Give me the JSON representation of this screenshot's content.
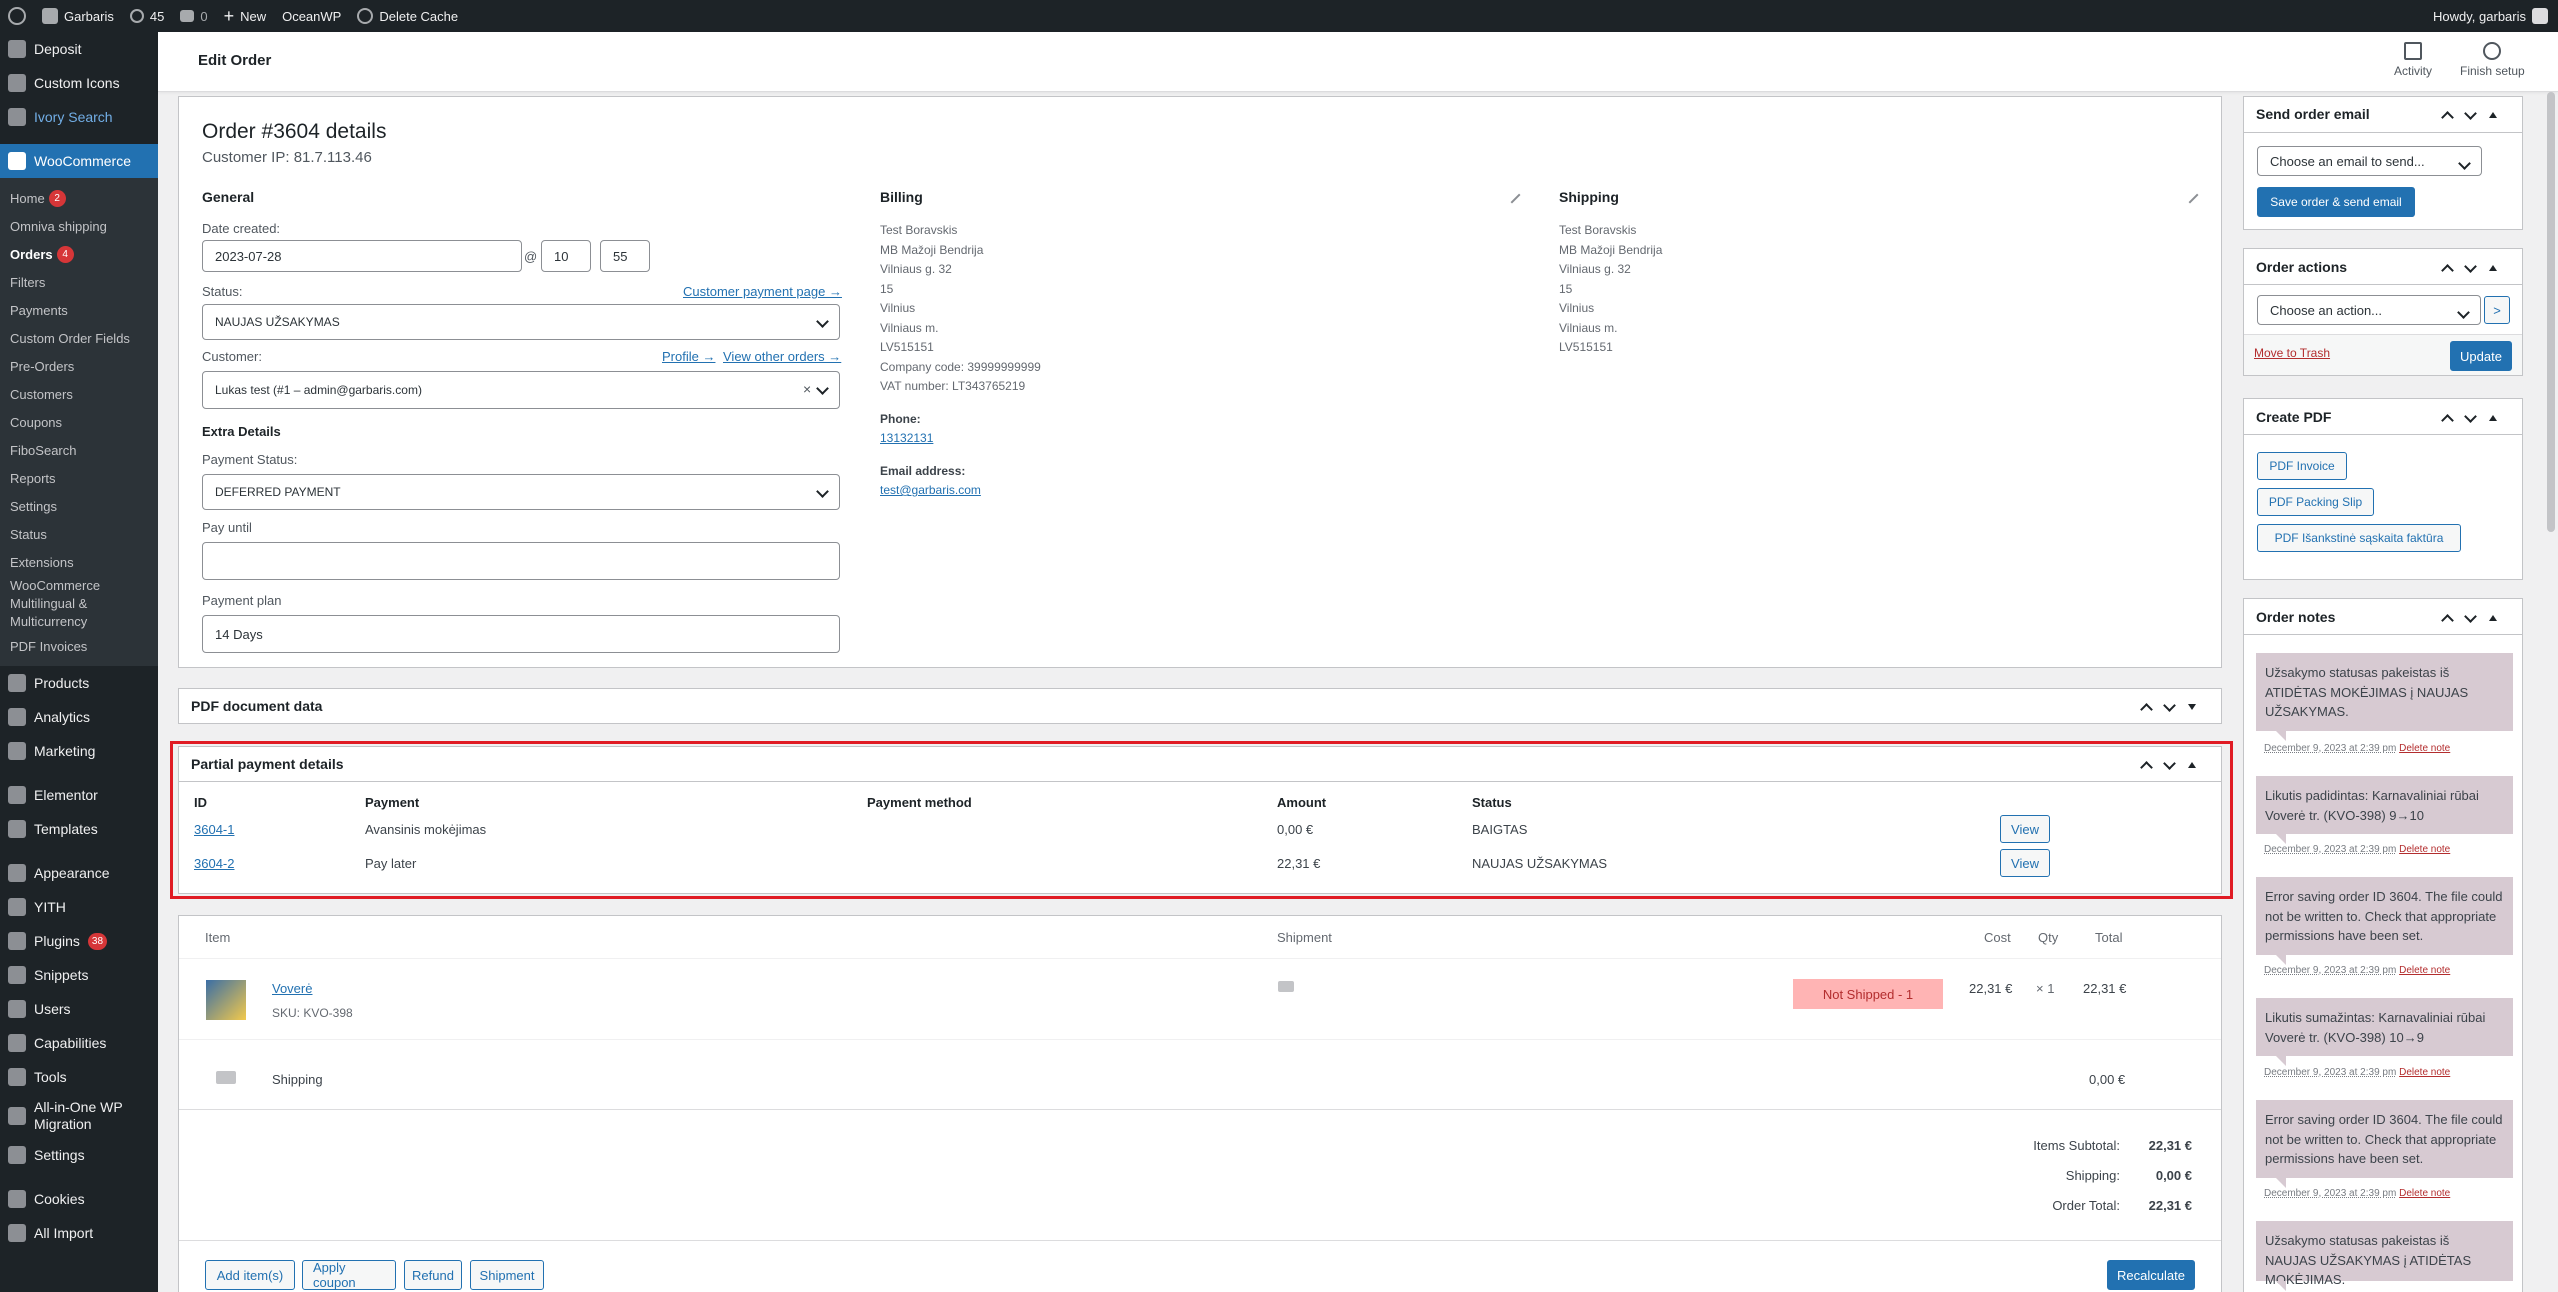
{
  "adminbar": {
    "site": "Garbaris",
    "updates": "45",
    "comments": "0",
    "new": "New",
    "oceanwp": "OceanWP",
    "cache": "Delete Cache",
    "howdy": "Howdy, garbaris"
  },
  "sidebar": {
    "top": [
      {
        "label": "Deposit"
      },
      {
        "label": "Custom Icons"
      },
      {
        "label": "Ivory Search"
      }
    ],
    "woo": "WooCommerce",
    "sub": [
      {
        "label": "Home",
        "badge": "2"
      },
      {
        "label": "Omniva shipping"
      },
      {
        "label": "Orders",
        "badge": "4"
      },
      {
        "label": "Filters"
      },
      {
        "label": "Payments"
      },
      {
        "label": "Custom Order Fields"
      },
      {
        "label": "Pre-Orders"
      },
      {
        "label": "Customers"
      },
      {
        "label": "Coupons"
      },
      {
        "label": "FiboSearch"
      },
      {
        "label": "Reports"
      },
      {
        "label": "Settings"
      },
      {
        "label": "Status"
      },
      {
        "label": "Extensions"
      },
      {
        "label": "WooCommerce Multilingual & Multicurrency"
      },
      {
        "label": "PDF Invoices"
      }
    ],
    "bottom": [
      {
        "label": "Products"
      },
      {
        "label": "Analytics"
      },
      {
        "label": "Marketing"
      },
      {
        "label": "Elementor"
      },
      {
        "label": "Templates"
      },
      {
        "label": "Appearance"
      },
      {
        "label": "YITH"
      },
      {
        "label": "Plugins",
        "badge": "38"
      },
      {
        "label": "Snippets"
      },
      {
        "label": "Users"
      },
      {
        "label": "Capabilities"
      },
      {
        "label": "Tools"
      },
      {
        "label": "All-in-One WP Migration"
      },
      {
        "label": "Settings"
      },
      {
        "label": "Cookies"
      },
      {
        "label": "All Import"
      }
    ]
  },
  "header": {
    "title": "Edit Order",
    "activity": "Activity",
    "finish": "Finish setup"
  },
  "order": {
    "title": "Order #3604 details",
    "ip": "Customer IP: 81.7.113.46",
    "general": "General",
    "date_label": "Date created:",
    "date": "2023-07-28",
    "at": "@",
    "hour": "10",
    "minute": "55",
    "status_label": "Status:",
    "payment_page": "Customer payment page →",
    "status": "NAUJAS UŽSAKYMAS",
    "customer_label": "Customer:",
    "profile": "Profile →",
    "other_orders": "View other orders →",
    "customer": "Lukas test (#1 – admin@garbaris.com)",
    "clear": "×",
    "extra": "Extra Details",
    "pay_status_label": "Payment Status:",
    "pay_status": "DEFERRED PAYMENT",
    "pay_until_label": "Pay until",
    "pay_until": "",
    "plan_label": "Payment plan",
    "plan": "14 Days",
    "billing": "Billing",
    "billing_lines": [
      "Test Boravskis",
      "MB Mažoji Bendrija",
      "Vilniaus g. 32",
      "15",
      "Vilnius",
      "Vilniaus m.",
      "LV515151",
      "Company code: 39999999999",
      "VAT number: LT343765219"
    ],
    "phone_label": "Phone:",
    "phone": "13132131",
    "email_label": "Email address:",
    "email": "test@garbaris.com",
    "shipping": "Shipping",
    "shipping_lines": [
      "Test Boravskis",
      "MB Mažoji Bendrija",
      "Vilniaus g. 32",
      "15",
      "Vilnius",
      "Vilniaus m.",
      "LV515151"
    ]
  },
  "pdfbox": {
    "title": "PDF document data"
  },
  "partial": {
    "title": "Partial payment details",
    "cols": [
      "ID",
      "Payment",
      "Payment method",
      "Amount",
      "Status"
    ],
    "rows": [
      {
        "id": "3604-1",
        "payment": "Avansinis mokėjimas",
        "method": "",
        "amount": "0,00 €",
        "status": "BAIGTAS",
        "view": "View"
      },
      {
        "id": "3604-2",
        "payment": "Pay later",
        "method": "",
        "amount": "22,31 €",
        "status": "NAUJAS UŽSAKYMAS",
        "view": "View"
      }
    ]
  },
  "items": {
    "cols": {
      "item": "Item",
      "shipment": "Shipment",
      "cost": "Cost",
      "qty": "Qty",
      "total": "Total"
    },
    "product": {
      "name": "Voverė",
      "sku": "SKU: KVO-398",
      "badge": "Not Shipped - 1",
      "cost": "22,31 €",
      "qty": "× 1",
      "total": "22,31 €"
    },
    "shipping": {
      "label": "Shipping",
      "total": "0,00 €"
    },
    "totals": [
      {
        "label": "Items Subtotal:",
        "value": "22,31 €"
      },
      {
        "label": "Shipping:",
        "value": "0,00 €"
      },
      {
        "label": "Order Total:",
        "value": "22,31 €"
      }
    ],
    "buttons": {
      "add": "Add item(s)",
      "coupon": "Apply coupon",
      "refund": "Refund",
      "shipment": "Shipment",
      "recalc": "Recalculate"
    }
  },
  "send_email": {
    "title": "Send order email",
    "placeholder": "Choose an email to send...",
    "button": "Save order & send email"
  },
  "actions": {
    "title": "Order actions",
    "placeholder": "Choose an action...",
    "go": ">",
    "trash": "Move to Trash",
    "update": "Update"
  },
  "create_pdf": {
    "title": "Create PDF",
    "buttons": [
      "PDF Invoice",
      "PDF Packing Slip",
      "PDF Išankstinė sąskaita faktūra"
    ]
  },
  "notes": {
    "title": "Order notes",
    "delete": "Delete note",
    "items": [
      {
        "text": "Užsakymo statusas pakeistas iš ATIDĖTAS MOKĖJIMAS į NAUJAS UŽSAKYMAS.",
        "date": "December 9, 2023 at 2:39 pm"
      },
      {
        "text": "Likutis padidintas: Karnavaliniai rūbai Voverė tr. (KVO-398) 9→10",
        "date": "December 9, 2023 at 2:39 pm"
      },
      {
        "text": "Error saving order ID 3604. The file could not be written to. Check that appropriate permissions have been set.",
        "date": "December 9, 2023 at 2:39 pm"
      },
      {
        "text": "Likutis sumažintas: Karnavaliniai rūbai Voverė tr. (KVO-398) 10→9",
        "date": "December 9, 2023 at 2:39 pm"
      },
      {
        "text": "Error saving order ID 3604. The file could not be written to. Check that appropriate permissions have been set.",
        "date": "December 9, 2023 at 2:39 pm"
      },
      {
        "text": "Užsakymo statusas pakeistas iš NAUJAS UŽSAKYMAS į ATIDĖTAS MOKĖJIMAS.",
        "date": ""
      }
    ]
  }
}
